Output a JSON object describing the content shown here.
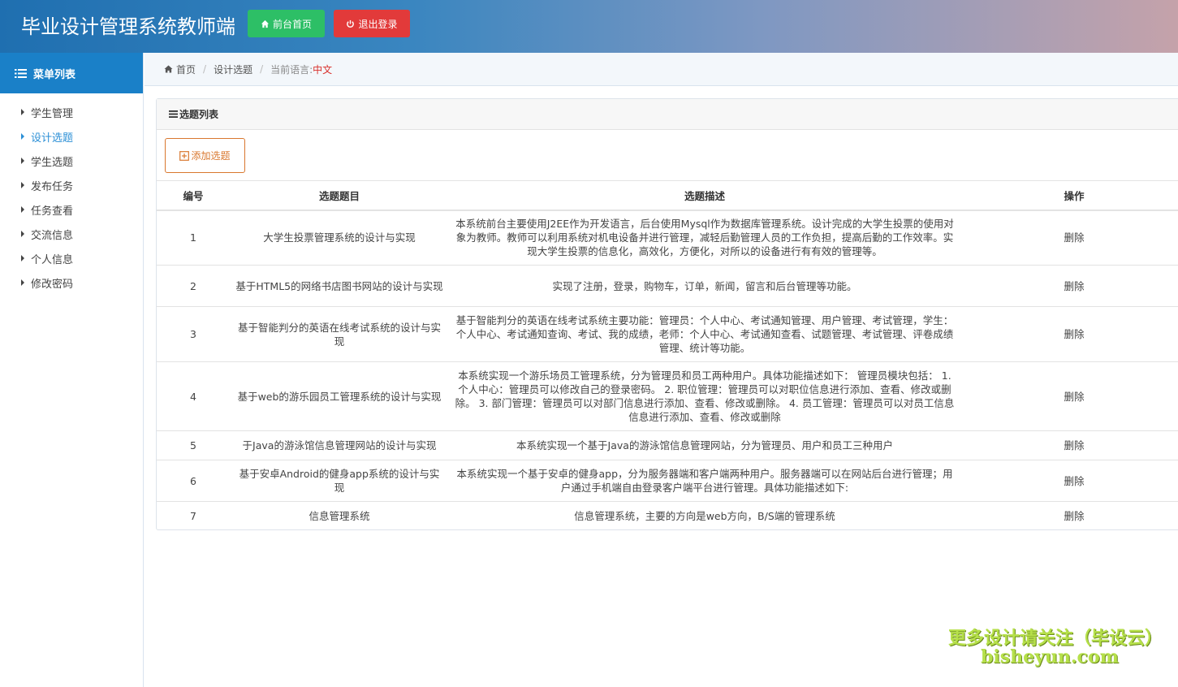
{
  "header": {
    "title": "毕业设计管理系统教师端",
    "home_button": "前台首页",
    "logout_button": "退出登录"
  },
  "sidebar": {
    "heading": "菜单列表",
    "items": [
      {
        "label": "学生管理",
        "active": false
      },
      {
        "label": "设计选题",
        "active": true
      },
      {
        "label": "学生选题",
        "active": false
      },
      {
        "label": "发布任务",
        "active": false
      },
      {
        "label": "任务查看",
        "active": false
      },
      {
        "label": "交流信息",
        "active": false
      },
      {
        "label": "个人信息",
        "active": false
      },
      {
        "label": "修改密码",
        "active": false
      }
    ]
  },
  "breadcrumb": {
    "home": "首页",
    "current": "设计选题",
    "lang_label": "当前语言:",
    "lang_value": "中文"
  },
  "panel": {
    "title": "选题列表",
    "add_button": "添加选题"
  },
  "table": {
    "headers": [
      "编号",
      "选题题目",
      "选题描述",
      "操作"
    ],
    "rows": [
      {
        "id": "1",
        "title": "大学生投票管理系统的设计与实现",
        "desc": "本系统前台主要使用J2EE作为开发语言，后台使用Mysql作为数据库管理系统。设计完成的大学生投票的使用对象为教师。教师可以利用系统对机电设备并进行管理，减轻后勤管理人员的工作负担，提高后勤的工作效率。实现大学生投票的信息化，高效化，方便化，对所以的设备进行有有效的管理等。",
        "op": "删除"
      },
      {
        "id": "2",
        "title": "基于HTML5的网络书店图书网站的设计与实现",
        "desc": "实现了注册，登录，购物车，订单，新闻，留言和后台管理等功能。",
        "op": "删除"
      },
      {
        "id": "3",
        "title": "基于智能判分的英语在线考试系统的设计与实现",
        "desc": "基于智能判分的英语在线考试系统主要功能：管理员：个人中心、考试通知管理、用户管理、考试管理，学生：个人中心、考试通知查询、考试、我的成绩，老师：个人中心、考试通知查看、试题管理、考试管理、评卷成绩管理、统计等功能。",
        "op": "删除"
      },
      {
        "id": "4",
        "title": "基于web的游乐园员工管理系统的设计与实现",
        "desc": "本系统实现一个游乐场员工管理系统，分为管理员和员工两种用户。具体功能描述如下： 管理员模块包括： 1. 个人中心：管理员可以修改自己的登录密码。 2. 职位管理：管理员可以对职位信息进行添加、查看、修改或删除。 3. 部门管理：管理员可以对部门信息进行添加、查看、修改或删除。 4. 员工管理：管理员可以对员工信息信息进行添加、查看、修改或删除",
        "op": "删除"
      },
      {
        "id": "5",
        "title": "于Java的游泳馆信息管理网站的设计与实现",
        "desc": "本系统实现一个基于Java的游泳馆信息管理网站，分为管理员、用户和员工三种用户",
        "op": "删除"
      },
      {
        "id": "6",
        "title": "基于安卓Android的健身app系统的设计与实现",
        "desc": "本系统实现一个基于安卓的健身app，分为服务器端和客户端两种用户。服务器端可以在网站后台进行管理；用户通过手机端自由登录客户端平台进行管理。具体功能描述如下:",
        "op": "删除"
      },
      {
        "id": "7",
        "title": "信息管理系统",
        "desc": "信息管理系统，主要的方向是web方向，B/S端的管理系统",
        "op": "删除"
      }
    ]
  },
  "watermark": {
    "line1": "更多设计请关注（毕设云）",
    "line2": "bisheyun.com"
  }
}
